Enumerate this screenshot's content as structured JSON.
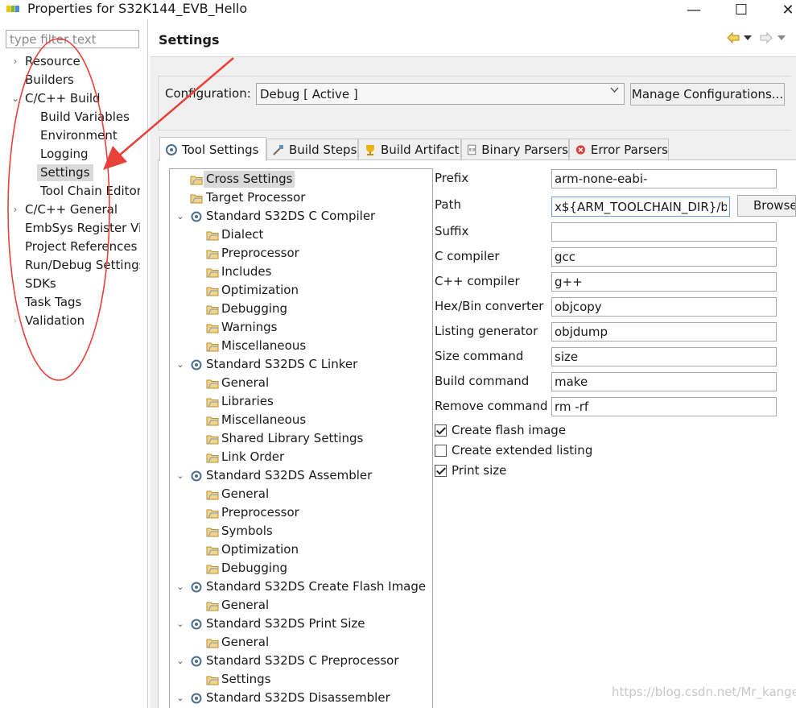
{
  "window": {
    "title": "Properties for S32K144_EVB_Hello",
    "minimize": "—",
    "maximize": "☐",
    "close": "✕"
  },
  "filter": {
    "placeholder": "type filter text"
  },
  "nav": {
    "items": [
      {
        "label": "Resource",
        "arrow": "›"
      },
      {
        "label": "Builders",
        "arrow": ""
      },
      {
        "label": "C/C++ Build",
        "arrow": "⌄"
      },
      {
        "label": "Build Variables",
        "arrow": ""
      },
      {
        "label": "Environment",
        "arrow": ""
      },
      {
        "label": "Logging",
        "arrow": ""
      },
      {
        "label": "Settings",
        "arrow": ""
      },
      {
        "label": "Tool Chain Editor",
        "arrow": ""
      },
      {
        "label": "C/C++ General",
        "arrow": "›"
      },
      {
        "label": "EmbSys Register View",
        "arrow": ""
      },
      {
        "label": "Project References",
        "arrow": ""
      },
      {
        "label": "Run/Debug Settings",
        "arrow": ""
      },
      {
        "label": "SDKs",
        "arrow": ""
      },
      {
        "label": "Task Tags",
        "arrow": ""
      },
      {
        "label": "Validation",
        "arrow": "›"
      }
    ]
  },
  "header": {
    "title": "Settings"
  },
  "configuration": {
    "label": "Configuration:",
    "value": "Debug  [ Active ]",
    "manage_label": "Manage Configurations..."
  },
  "tabs": [
    {
      "label": "Tool Settings",
      "icon": "tool-settings-icon"
    },
    {
      "label": "Build Steps",
      "icon": "build-steps-icon"
    },
    {
      "label": "Build Artifact",
      "icon": "trophy-icon"
    },
    {
      "label": "Binary Parsers",
      "icon": "binary-icon"
    },
    {
      "label": "Error Parsers",
      "icon": "error-icon"
    }
  ],
  "tree": [
    {
      "label": "Cross Settings"
    },
    {
      "label": "Target Processor"
    },
    {
      "label": "Standard S32DS C Compiler"
    },
    {
      "label": "Dialect"
    },
    {
      "label": "Preprocessor"
    },
    {
      "label": "Includes"
    },
    {
      "label": "Optimization"
    },
    {
      "label": "Debugging"
    },
    {
      "label": "Warnings"
    },
    {
      "label": "Miscellaneous"
    },
    {
      "label": "Standard S32DS C Linker"
    },
    {
      "label": "General"
    },
    {
      "label": "Libraries"
    },
    {
      "label": "Miscellaneous"
    },
    {
      "label": "Shared Library Settings"
    },
    {
      "label": "Link Order"
    },
    {
      "label": "Standard S32DS Assembler"
    },
    {
      "label": "General"
    },
    {
      "label": "Preprocessor"
    },
    {
      "label": "Symbols"
    },
    {
      "label": "Optimization"
    },
    {
      "label": "Debugging"
    },
    {
      "label": "Standard S32DS Create Flash Image"
    },
    {
      "label": "General"
    },
    {
      "label": "Standard S32DS Print Size"
    },
    {
      "label": "General"
    },
    {
      "label": "Standard S32DS C Preprocessor"
    },
    {
      "label": "Settings"
    },
    {
      "label": "Standard S32DS Disassembler"
    }
  ],
  "fields": [
    {
      "label": "Prefix",
      "value": "arm-none-eabi-"
    },
    {
      "label": "Path",
      "value": "x${ARM_TOOLCHAIN_DIR}/bin"
    },
    {
      "label": "Suffix",
      "value": ""
    },
    {
      "label": "C compiler",
      "value": "gcc"
    },
    {
      "label": "C++ compiler",
      "value": "g++"
    },
    {
      "label": "Hex/Bin converter",
      "value": "objcopy"
    },
    {
      "label": "Listing generator",
      "value": "objdump"
    },
    {
      "label": "Size command",
      "value": "size"
    },
    {
      "label": "Build command",
      "value": "make"
    },
    {
      "label": "Remove command",
      "value": "rm -rf"
    }
  ],
  "browse_label": "Browse...",
  "checks": [
    {
      "label": "Create flash image",
      "checked": true
    },
    {
      "label": "Create extended listing",
      "checked": false
    },
    {
      "label": "Print size",
      "checked": true
    }
  ],
  "watermark": "https://blog.csdn.net/Mr_kanger",
  "colors": {
    "annotation_red": "#e8413a",
    "selection_gray": "#d9d9d9",
    "background": "#f0f0f0"
  }
}
